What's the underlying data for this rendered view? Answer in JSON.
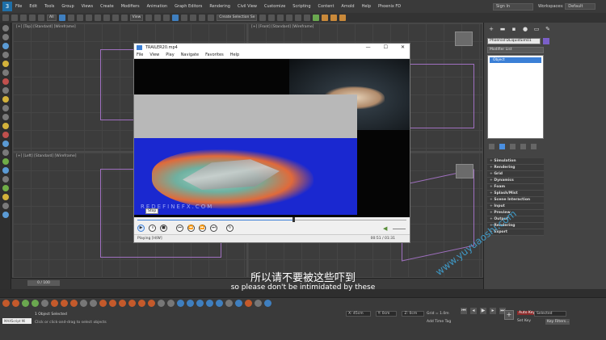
{
  "menubar": {
    "items": [
      "File",
      "Edit",
      "Tools",
      "Group",
      "Views",
      "Create",
      "Modifiers",
      "Animation",
      "Graph Editors",
      "Rendering",
      "Civil View",
      "Customize",
      "Scripting",
      "Content",
      "Arnold",
      "Help",
      "Phoenix FD"
    ],
    "sign_in": "Sign In",
    "workspaces_label": "Workspaces:",
    "workspaces_value": "Default"
  },
  "toolbar": {
    "filter": "All",
    "ref_coord": "View",
    "selection_set": "Create Selection Se"
  },
  "viewports": {
    "top_left": "[+] [Top] [Standard] [Wireframe]",
    "top_right": "[+] [Front] [Standard] [Wireframe]",
    "bottom_left": "[+] [Left] [Standard] [Wireframe]"
  },
  "command_panel": {
    "object_name": "PhoenixFDLiquidSim01",
    "modifier_list": "Modifier List",
    "stack_item": "Object",
    "rollouts": [
      "Simulation",
      "Rendering",
      "Grid",
      "Dynamics",
      "Foam",
      "Splash/Mist",
      "Scene Interaction",
      "Input",
      "Preview",
      "Output",
      "Rendering",
      "Export"
    ]
  },
  "player": {
    "title": "TRAILER20.mp4",
    "menu": [
      "File",
      "View",
      "Play",
      "Navigate",
      "Favorites",
      "Help"
    ],
    "watermark": "REDEFINEFX.COM",
    "tooltip": "Stop",
    "status": "Playing [H/W]",
    "time": "00:51 / 01:31",
    "progress": 0.58
  },
  "subtitles": {
    "chinese": "所以请不要被这些吓到",
    "english": "so please don't be intimidated by these"
  },
  "site_watermark": "www.yuyuaoshi.com",
  "timeline": {
    "frame": "0 / 100"
  },
  "status": {
    "selection": "1 Object Selected",
    "hint": "Click or click-and-drag to select objects",
    "maxscript": "MAXScript Mi",
    "x": "X: 45cm",
    "y": "Y: 0cm",
    "z": "Z: 0cm",
    "grid": "Grid = 1.0m",
    "add_time_tag": "Add Time Tag",
    "auto_key": "Auto Key",
    "selected": "Selected",
    "set_key": "Set Key",
    "key_filters": "Key Filters..."
  }
}
